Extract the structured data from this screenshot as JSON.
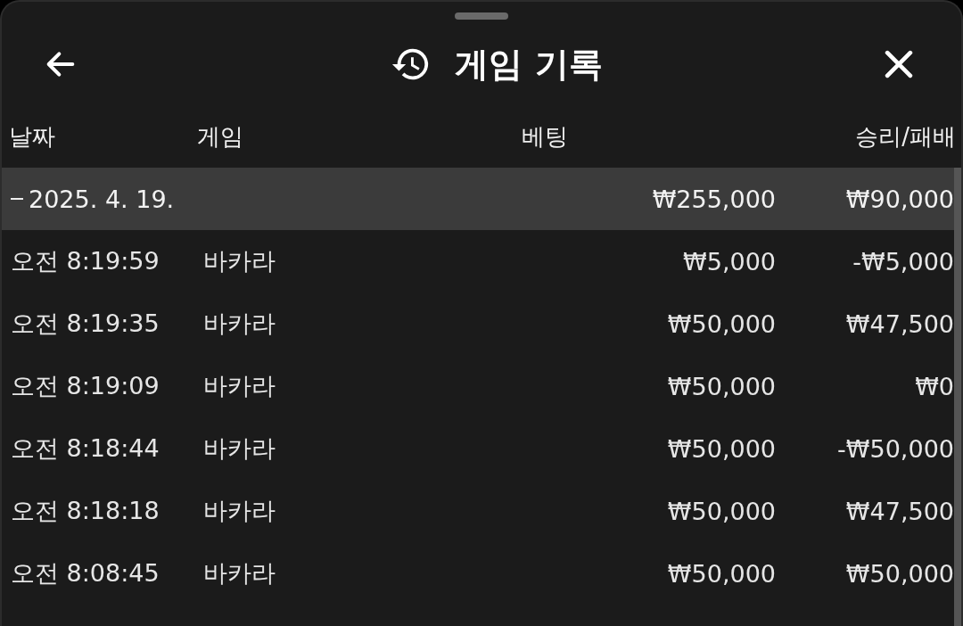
{
  "header": {
    "title": "게임 기록"
  },
  "table": {
    "columns": [
      "날짜",
      "게임",
      "베팅",
      "승리/패배"
    ],
    "groups": [
      {
        "date": "2025. 4. 19.",
        "expanded": true,
        "bet": "₩255,000",
        "result": "₩90,000",
        "rows": [
          {
            "time": "오전 8:19:59",
            "game": "바카라",
            "bet": "₩5,000",
            "result": "-₩5,000"
          },
          {
            "time": "오전 8:19:35",
            "game": "바카라",
            "bet": "₩50,000",
            "result": "₩47,500"
          },
          {
            "time": "오전 8:19:09",
            "game": "바카라",
            "bet": "₩50,000",
            "result": "₩0"
          },
          {
            "time": "오전 8:18:44",
            "game": "바카라",
            "bet": "₩50,000",
            "result": "-₩50,000"
          },
          {
            "time": "오전 8:18:18",
            "game": "바카라",
            "bet": "₩50,000",
            "result": "₩47,500"
          },
          {
            "time": "오전 8:08:45",
            "game": "바카라",
            "bet": "₩50,000",
            "result": "₩50,000"
          }
        ]
      }
    ]
  }
}
